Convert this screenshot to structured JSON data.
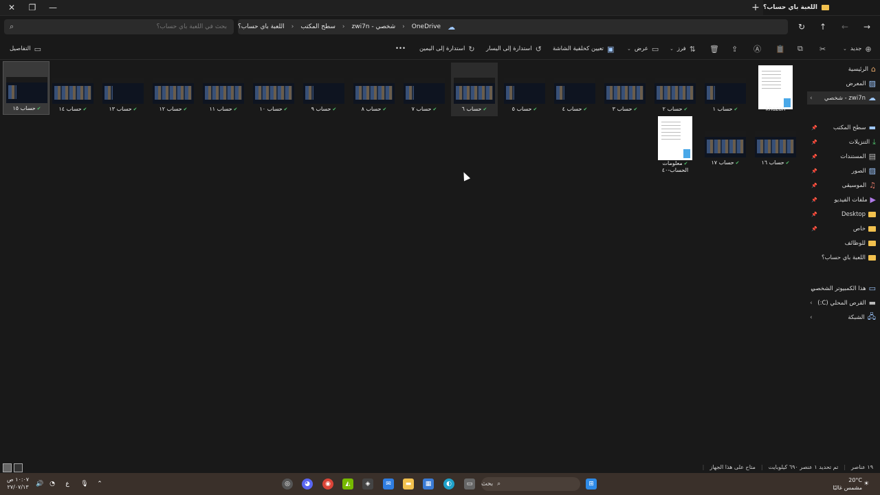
{
  "window": {
    "tab_title": "اللعبة باي حساب؟",
    "close_glyph": "✕",
    "new_tab_glyph": "+"
  },
  "navigation": {
    "search_placeholder": "بحث في اللعبة باي حساب؟",
    "breadcrumb": [
      "OneDrive",
      "شخصي - zwi7n",
      "سطح المكتب",
      "اللعبة باي حساب؟"
    ]
  },
  "toolbar": {
    "new_label": "جديد",
    "sort_label": "فرز",
    "view_label": "عرض",
    "set_background_label": "تعيين كخلفية الشاشة",
    "rotate_left_label": "استدارة إلى اليسار",
    "rotate_right_label": "استدارة إلى اليمين",
    "more_glyph": "•••",
    "details_label": "التفاصيل"
  },
  "sidebar": {
    "items": [
      {
        "label": "الرئيسية"
      },
      {
        "label": "المعرض"
      },
      {
        "label": "zwi7n - شخصي"
      },
      {
        "label": "سطح المكتب"
      },
      {
        "label": "التنزيلات"
      },
      {
        "label": "المستندات"
      },
      {
        "label": "الصور"
      },
      {
        "label": "الموسيقى"
      },
      {
        "label": "ملفات الفيديو"
      },
      {
        "label": "Desktop"
      },
      {
        "label": "خاص"
      },
      {
        "label": "للوظائف"
      },
      {
        "label": "اللعبة باي حساب؟"
      },
      {
        "label": "هذا الكمبيوتر الشخصي"
      },
      {
        "label": "القرص المحلي (C:)"
      },
      {
        "label": "الشبكة"
      }
    ]
  },
  "files": [
    {
      "name": "khazan"
    },
    {
      "name": "حساب ١"
    },
    {
      "name": "حساب ٢"
    },
    {
      "name": "حساب ٣"
    },
    {
      "name": "حساب ٤"
    },
    {
      "name": "حساب ٥"
    },
    {
      "name": "حساب ٦"
    },
    {
      "name": "حساب ٧"
    },
    {
      "name": "حساب ٨"
    },
    {
      "name": "حساب ٩"
    },
    {
      "name": "حساب ١٠"
    },
    {
      "name": "حساب ١١"
    },
    {
      "name": "حساب ١٢"
    },
    {
      "name": "حساب ١٣"
    },
    {
      "name": "حساب ١٤"
    },
    {
      "name": "حساب ١٥"
    },
    {
      "name": "حساب ١٦"
    },
    {
      "name": "حساب ١٧"
    },
    {
      "name": "معلومات الحساب-٤٠"
    }
  ],
  "status": {
    "item_count": "١٩ عناصر",
    "selection": "تم تحديد ١ عنصر ٦٩٠ كيلوبايت",
    "availability": "متاح على هذا الجهاز"
  },
  "taskbar": {
    "search_label": "بحث",
    "time": "١٠:٠٧ ص",
    "date": "٢٧/٠٧/١٣",
    "temperature": "20°C",
    "weather": "مشمس غالبًا",
    "language": "ع"
  }
}
